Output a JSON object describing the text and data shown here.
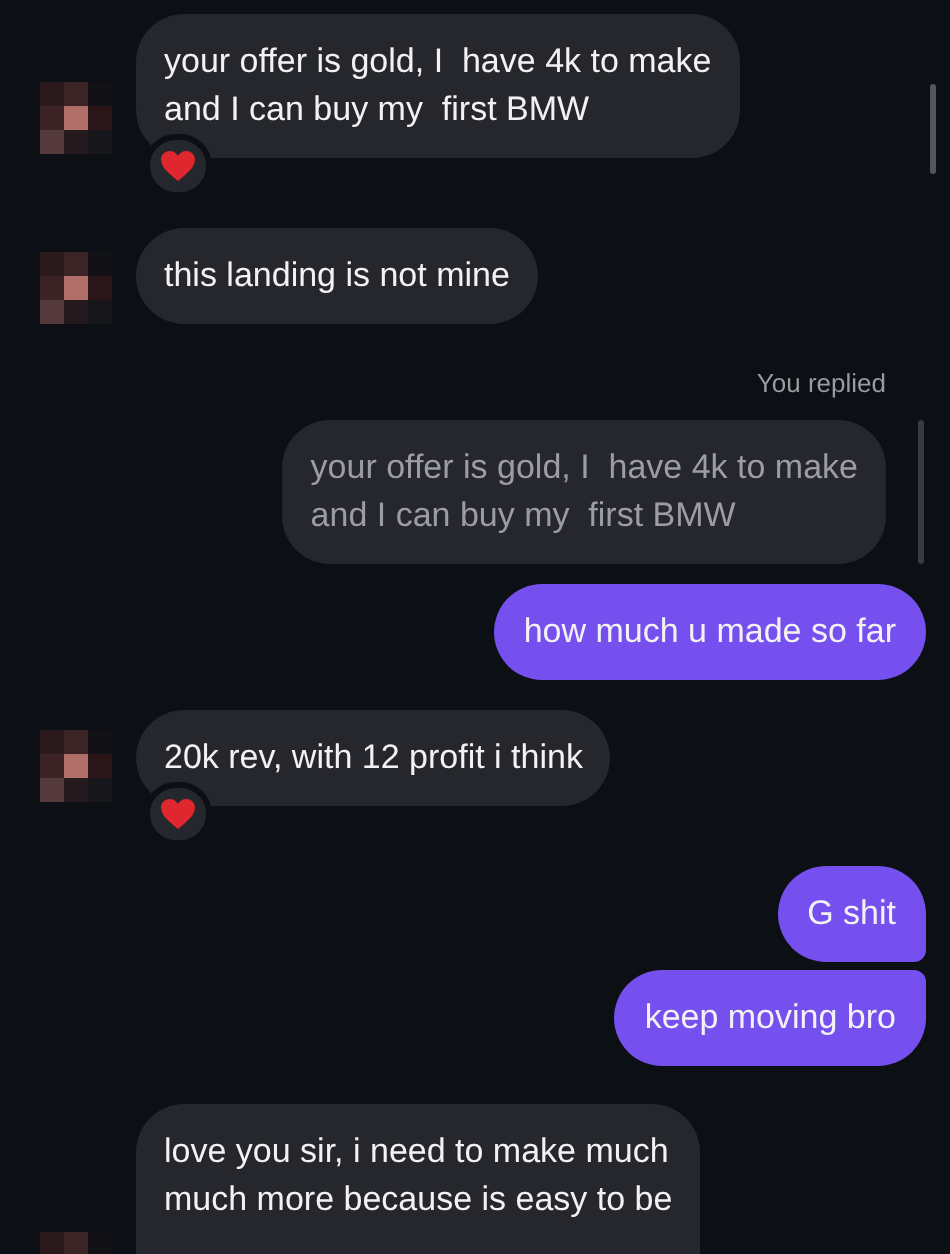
{
  "messages": [
    {
      "kind": "incoming",
      "text": "your offer is gold, I  have 4k to make\nand I can buy my  first BMW",
      "reacted": true
    },
    {
      "kind": "incoming",
      "text": "this landing is not mine",
      "reacted": false
    },
    {
      "kind": "reply-label",
      "text": "You replied"
    },
    {
      "kind": "quoted",
      "text": "your offer is gold, I  have 4k to make\nand I can buy my  first BMW"
    },
    {
      "kind": "outgoing",
      "text": "how much u made so far"
    },
    {
      "kind": "incoming",
      "text": "20k rev, with 12 profit i think",
      "reacted": true
    },
    {
      "kind": "outgoing",
      "text": "G shit"
    },
    {
      "kind": "outgoing",
      "text": "keep moving bro"
    },
    {
      "kind": "incoming",
      "text": "love you sir, i need to make much\nmuch more because is easy to be",
      "reacted": false
    }
  ]
}
